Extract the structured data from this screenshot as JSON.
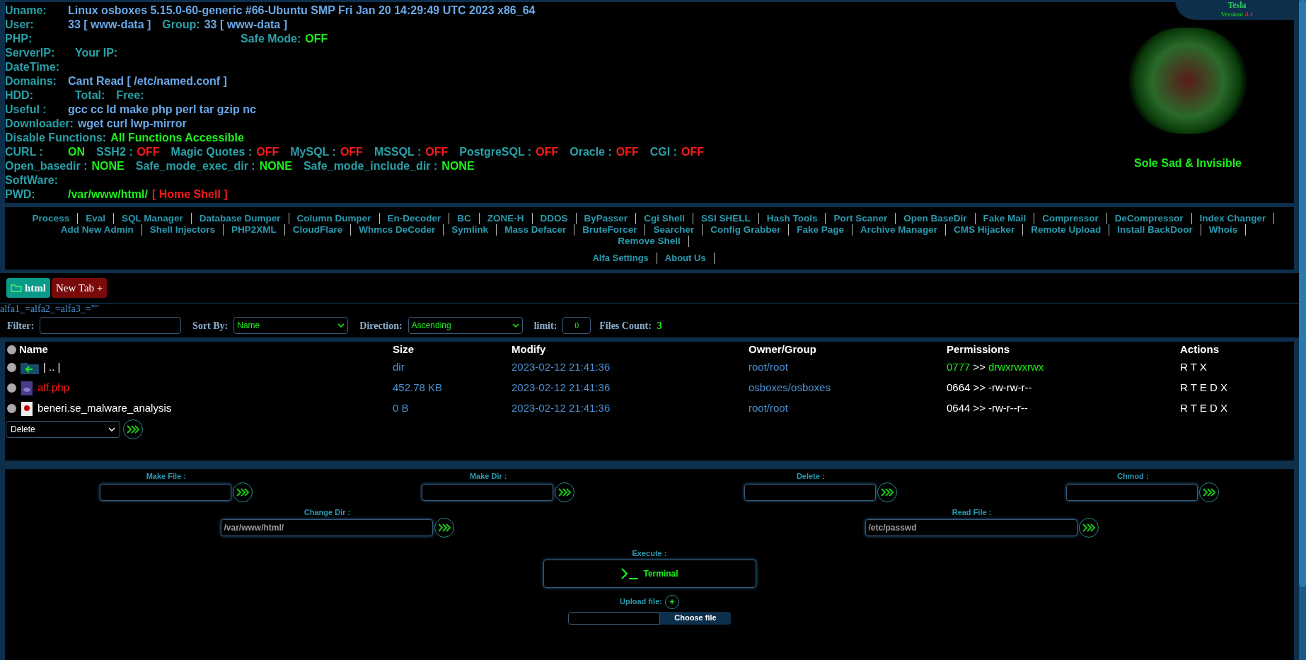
{
  "info": [
    [
      {
        "label": "Uname:",
        "value": "Linux osboxes 5.15.0-60-generic #66-Ubuntu SMP Fri Jan 20 14:29:49 UTC 2023 x86_64",
        "color": "#6aa8e8"
      }
    ],
    [
      {
        "label": "User:",
        "value": "33 [ www-data ]",
        "color": "#6aa8e8"
      },
      {
        "label": "Group:",
        "value": "33 [ www-data ]",
        "color": "#6aa8e8"
      }
    ],
    [
      {
        "label": "PHP:"
      },
      {
        "label": "Safe Mode:",
        "value": "OFF",
        "color": "#1cf01c"
      }
    ],
    [
      {
        "label": "ServerIP:"
      },
      {
        "label": "Your IP:"
      }
    ],
    [
      {
        "label": "DateTime:"
      }
    ],
    [
      {
        "label": "Domains:",
        "value": "Cant Read [ /etc/named.conf ]",
        "color": "#6aa8e8"
      }
    ],
    [
      {
        "label": "HDD:"
      },
      {
        "label": "Total:"
      },
      {
        "label": "Free:"
      }
    ],
    [
      {
        "label": "Useful :",
        "value": "gcc cc ld make php perl tar gzip nc",
        "color": "#6aa8e8"
      }
    ],
    [
      {
        "label": "Downloader:",
        "value": "wget curl lwp-mirror",
        "color": "#6aa8e8"
      }
    ],
    [
      {
        "label": "Disable Functions:",
        "value": "All Functions Accessible",
        "color": "#1cf01c"
      }
    ],
    [
      {
        "label": "CURL :",
        "value": "ON",
        "color": "#1cf01c"
      },
      {
        "label": "SSH2 :",
        "value": "OFF",
        "color": "#ff1a1a"
      },
      {
        "label": "Magic Quotes :",
        "value": "OFF",
        "color": "#ff1a1a"
      },
      {
        "label": "MySQL :",
        "value": "OFF",
        "color": "#ff1a1a"
      },
      {
        "label": "MSSQL :",
        "value": "OFF",
        "color": "#ff1a1a"
      },
      {
        "label": "PostgreSQL :",
        "value": "OFF",
        "color": "#ff1a1a"
      },
      {
        "label": "Oracle :",
        "value": "OFF",
        "color": "#ff1a1a"
      },
      {
        "label": "CGI :",
        "value": "OFF",
        "color": "#ff1a1a"
      }
    ],
    [
      {
        "label": "Open_basedir :",
        "value": "NONE",
        "color": "#1cf01c"
      },
      {
        "label": "Safe_mode_exec_dir :",
        "value": "NONE",
        "color": "#1cf01c"
      },
      {
        "label": "Safe_mode_include_dir :",
        "value": "NONE",
        "color": "#1cf01c"
      }
    ],
    [
      {
        "label": "SoftWare:"
      }
    ],
    [
      {
        "label": "PWD:",
        "value": "/var/www/html/",
        "color": "#1cf01c",
        "extra": "[ Home Shell ]"
      }
    ]
  ],
  "version_tab": {
    "name": "Tesla",
    "version_label": "Version:",
    "version": "4.1"
  },
  "slogan": "Sole Sad & Invisible",
  "menu": {
    "tools": [
      "Process",
      "Eval",
      "SQL Manager",
      "Database Dumper",
      "Column Dumper",
      "En-Decoder",
      "BC",
      "ZONE-H",
      "DDOS",
      "ByPasser",
      "Cgi Shell",
      "SSI SHELL",
      "Hash Tools",
      "Port Scaner",
      "Open BaseDir",
      "Fake Mail",
      "Compressor",
      "DeCompressor",
      "Index Changer",
      "Add New Admin",
      "Shell Injectors",
      "PHP2XML",
      "CloudFlare",
      "Whmcs DeCoder",
      "Symlink",
      "Mass Defacer",
      "BruteForcer",
      "Searcher",
      "Config Grabber",
      "Fake Page",
      "Archive Manager",
      "CMS Hijacker",
      "Remote Upload",
      "Install BackDoor",
      "Whois",
      "Remove Shell"
    ],
    "footer": [
      "Alfa Settings",
      "About Us"
    ]
  },
  "tabs": [
    {
      "label": "html",
      "kind": "folder",
      "selected": true
    },
    {
      "label": "New Tab +",
      "kind": "new",
      "selected": false
    }
  ],
  "query": "alfa1_=alfa2_=alfa3_=\"\"",
  "filter": {
    "filter_label": "Filter:",
    "sort_label": "Sort By:",
    "sort": "Name",
    "direction_label": "Direction:",
    "direction": "Ascending",
    "limit_label": "limit:",
    "limit": "0",
    "count_label": "Files Count:",
    "count": "3"
  },
  "table": {
    "select_all": false,
    "columns": [
      "Name",
      "Size",
      "Modify",
      "Owner/Group",
      "Permissions",
      "Actions"
    ],
    "rows": [
      {
        "kind": "back",
        "selected": false,
        "name": "| .. |",
        "size": "dir",
        "modify": "2023-02-12 21:41:36",
        "owner": "root/root",
        "octal": "0777",
        "arrow": ">>",
        "perms": "drwxrwxrwx",
        "writable": true,
        "actions": "R T X"
      },
      {
        "kind": "php",
        "selected": false,
        "name": "alf.php",
        "size": "452.78 KB",
        "modify": "2023-02-12 21:41:36",
        "owner": "osboxes/osboxes",
        "octal": "0664",
        "arrow": ">>",
        "perms": "-rw-rw-r--",
        "writable": false,
        "actions": "R T E D X"
      },
      {
        "kind": "file",
        "selected": false,
        "name": "beneri.se_malware_analysis",
        "size": "0 B",
        "modify": "2023-02-12 21:41:36",
        "owner": "root/root",
        "octal": "0644",
        "arrow": ">>",
        "perms": "-rw-r--r--",
        "writable": false,
        "actions": "R T E D X"
      }
    ],
    "bulk_action": "Delete"
  },
  "forms": {
    "row1": [
      {
        "label": "Make File :"
      },
      {
        "label": "Make Dir :"
      },
      {
        "label": "Delete :"
      },
      {
        "label": "Chmod :"
      }
    ],
    "row2": [
      {
        "label": "Change Dir :",
        "value": "/var/www/html/"
      },
      {
        "label": "Read File :",
        "value": "/etc/passwd"
      }
    ],
    "execute_label": "Execute :",
    "terminal": "Terminal",
    "upload_label": "Upload file:",
    "upload_plus": "+",
    "choose": "Choose file"
  }
}
